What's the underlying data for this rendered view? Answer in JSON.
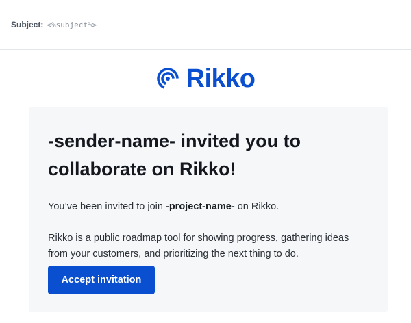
{
  "subject": {
    "label": "Subject:",
    "value": "<%subject%>"
  },
  "logo": {
    "icon": "broadcast-icon",
    "text": "Rikko",
    "color": "#0a4fcf"
  },
  "email": {
    "headline": "-sender-name- invited you to collaborate on Rikko!",
    "invite_prefix": "You’ve been invited to join ",
    "project_name": "-project-name-",
    "invite_suffix": " on Rikko.",
    "description": "Rikko is a public roadmap tool for showing progress, gathering ideas from your customers, and prioritizing the next thing to do.",
    "button_label": "Accept invitation"
  },
  "colors": {
    "accent": "#0a4fcf",
    "card_background": "#f6f7f9"
  }
}
